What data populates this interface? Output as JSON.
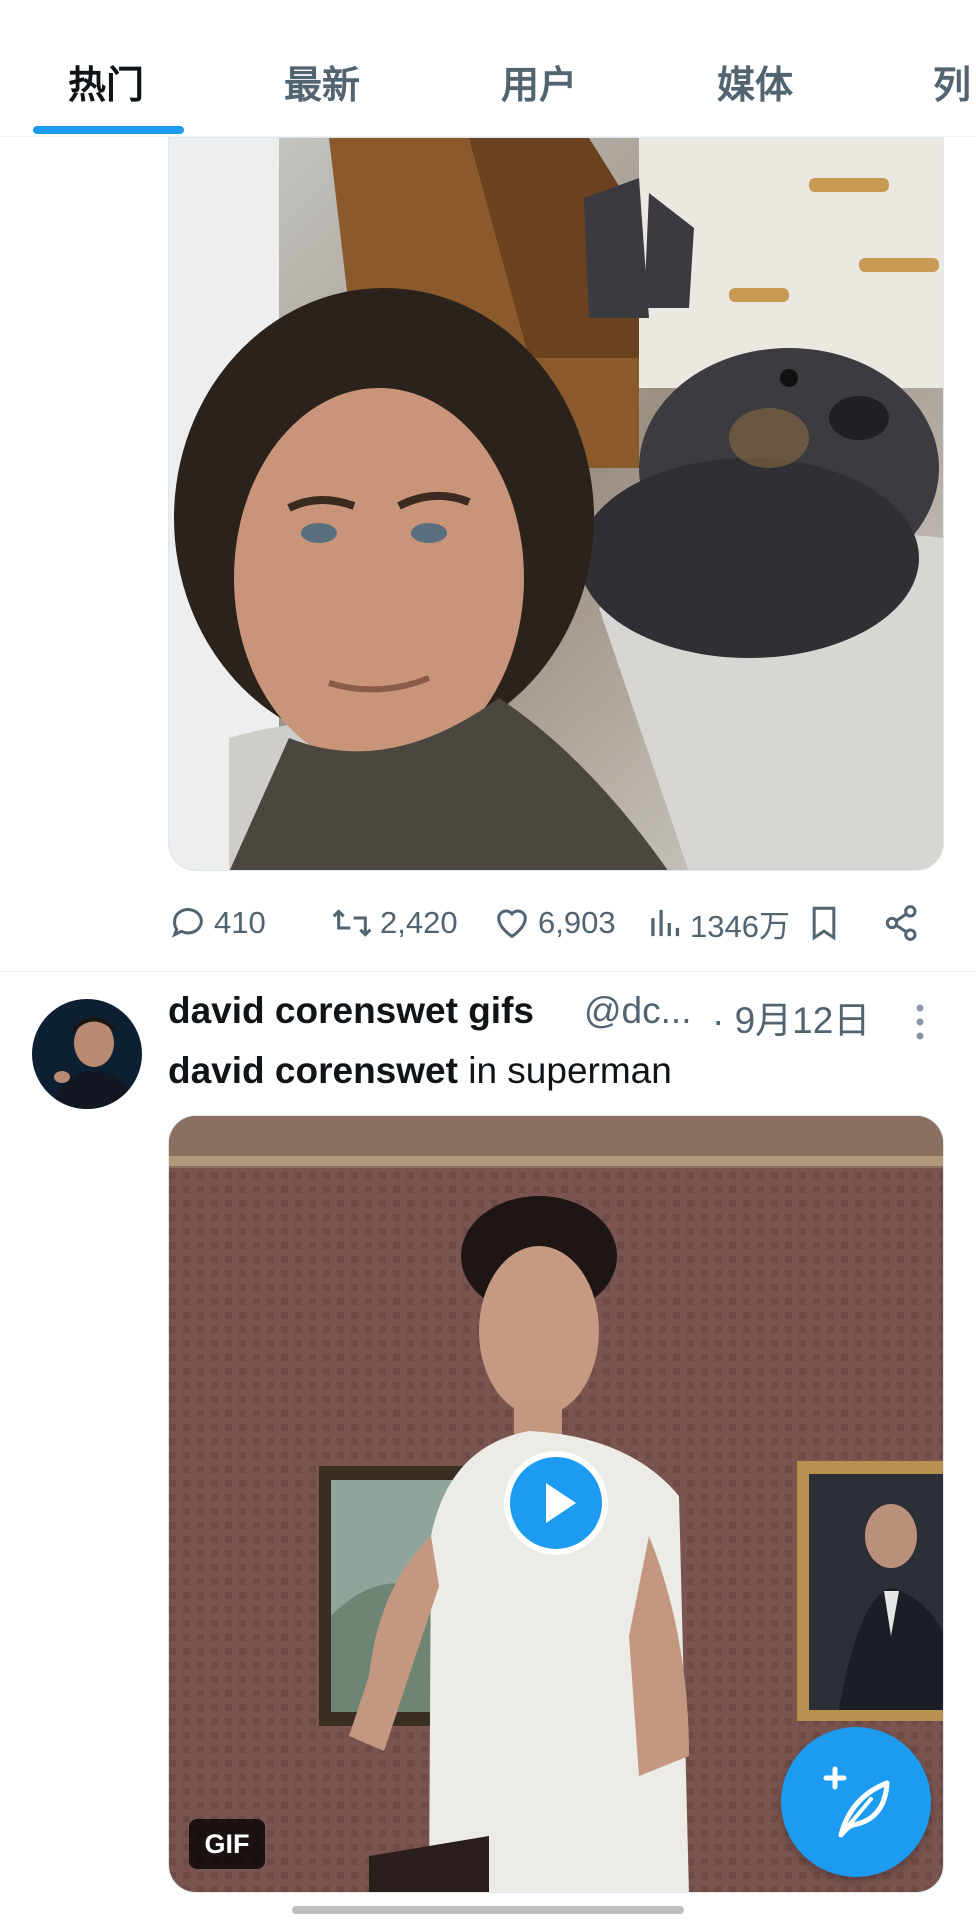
{
  "tabs": {
    "items": [
      {
        "label": "热门",
        "active": true
      },
      {
        "label": "最新",
        "active": false
      },
      {
        "label": "用户",
        "active": false
      },
      {
        "label": "媒体",
        "active": false
      },
      {
        "label": "列",
        "active": false
      }
    ],
    "accent_color": "#1d9bf0"
  },
  "post1": {
    "media_description": "selfie photo",
    "stats": {
      "replies": "410",
      "reposts": "2,420",
      "likes": "6,903",
      "views": "1346万"
    },
    "icons": [
      "reply-icon",
      "repost-icon",
      "like-icon",
      "views-icon",
      "bookmark-icon",
      "share-icon"
    ]
  },
  "post2": {
    "author_name": "david corenswet gifs",
    "handle": "@dc...",
    "date": "· 9月12日",
    "text_bold": "david corenswet",
    "text_rest": " in superman",
    "media_badge": "GIF"
  },
  "fab": {
    "icon": "compose-icon"
  }
}
